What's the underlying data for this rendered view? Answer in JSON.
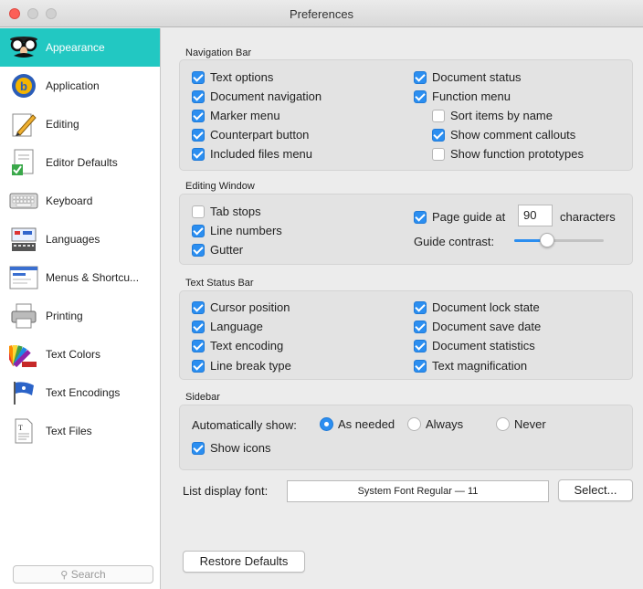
{
  "window": {
    "title": "Preferences"
  },
  "sidebar": {
    "items": [
      {
        "label": "Appearance",
        "icon": "disguise-glasses-icon",
        "selected": true
      },
      {
        "label": "Application",
        "icon": "bbedit-app-icon"
      },
      {
        "label": "Editing",
        "icon": "pencil-paper-icon"
      },
      {
        "label": "Editor Defaults",
        "icon": "document-checkmark-icon"
      },
      {
        "label": "Keyboard",
        "icon": "keyboard-icon"
      },
      {
        "label": "Languages",
        "icon": "languages-icon"
      },
      {
        "label": "Menus & Shortcu...",
        "icon": "menu-window-icon"
      },
      {
        "label": "Printing",
        "icon": "printer-icon"
      },
      {
        "label": "Text Colors",
        "icon": "color-swatches-icon"
      },
      {
        "label": "Text Encodings",
        "icon": "flag-icon"
      },
      {
        "label": "Text Files",
        "icon": "text-file-icon"
      }
    ],
    "search_placeholder": "Search"
  },
  "navigation_bar": {
    "label": "Navigation Bar",
    "left": [
      {
        "label": "Text options",
        "checked": true
      },
      {
        "label": "Document navigation",
        "checked": true
      },
      {
        "label": "Marker menu",
        "checked": true
      },
      {
        "label": "Counterpart button",
        "checked": true
      },
      {
        "label": "Included files menu",
        "checked": true
      }
    ],
    "right": [
      {
        "label": "Document status",
        "checked": true
      },
      {
        "label": "Function menu",
        "checked": true
      },
      {
        "label": "Sort items by name",
        "checked": false
      },
      {
        "label": "Show comment callouts",
        "checked": true
      },
      {
        "label": "Show function prototypes",
        "checked": false
      }
    ]
  },
  "editing_window": {
    "label": "Editing Window",
    "tab_stops": {
      "label": "Tab stops",
      "checked": false
    },
    "line_numbers": {
      "label": "Line numbers",
      "checked": true
    },
    "gutter": {
      "label": "Gutter",
      "checked": true
    },
    "page_guide": {
      "label": "Page guide at",
      "checked": true,
      "value": "90",
      "suffix": "characters"
    },
    "guide_contrast": {
      "label": "Guide contrast:",
      "level": 0.37
    }
  },
  "text_status_bar": {
    "label": "Text Status Bar",
    "left": [
      {
        "label": "Cursor position",
        "checked": true
      },
      {
        "label": "Language",
        "checked": true
      },
      {
        "label": "Text encoding",
        "checked": true
      },
      {
        "label": "Line break type",
        "checked": true
      }
    ],
    "right": [
      {
        "label": "Document lock state",
        "checked": true
      },
      {
        "label": "Document save date",
        "checked": true
      },
      {
        "label": "Document statistics",
        "checked": true
      },
      {
        "label": "Text magnification",
        "checked": true
      }
    ]
  },
  "sidebar_section": {
    "label": "Sidebar",
    "auto_show_label": "Automatically show:",
    "options": [
      {
        "label": "As needed",
        "selected": true
      },
      {
        "label": "Always",
        "selected": false
      },
      {
        "label": "Never",
        "selected": false
      }
    ],
    "show_icons": {
      "label": "Show icons",
      "checked": true
    }
  },
  "list_font": {
    "label": "List display font:",
    "value": "System Font Regular — 11",
    "button": "Select..."
  },
  "restore_button": "Restore Defaults",
  "colors": {
    "accent": "#2b8ef0",
    "selection": "#22c8c2"
  }
}
